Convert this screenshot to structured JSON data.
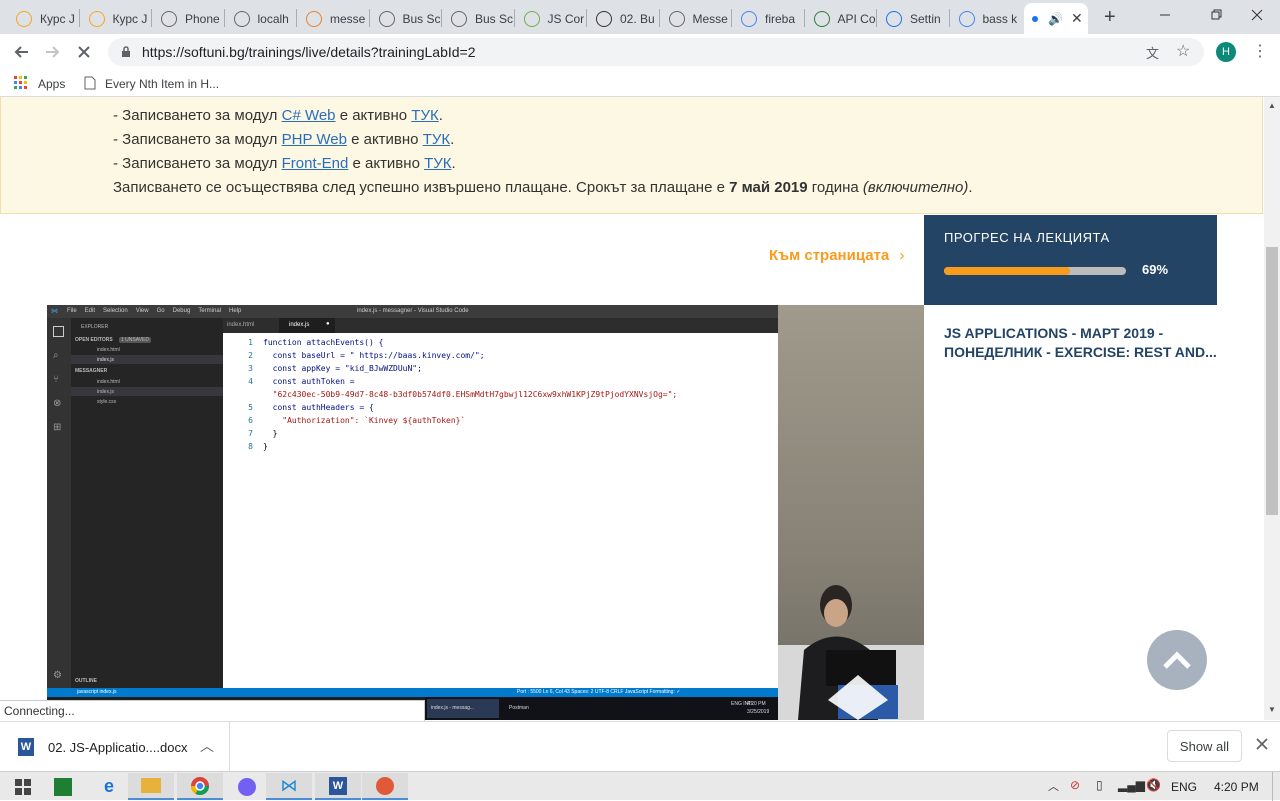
{
  "tabs": [
    {
      "title": "Курс J",
      "icon": "softuni-icon",
      "color": "#f5a623"
    },
    {
      "title": "Курс J",
      "icon": "softuni-icon",
      "color": "#f5a623"
    },
    {
      "title": "Phone",
      "icon": "document-icon",
      "color": "#666"
    },
    {
      "title": "localh",
      "icon": "document-icon",
      "color": "#666"
    },
    {
      "title": "messe",
      "icon": "bolt-icon",
      "color": "#e8832a"
    },
    {
      "title": "Bus Sc",
      "icon": "document-icon",
      "color": "#666"
    },
    {
      "title": "Bus Sc",
      "icon": "document-icon",
      "color": "#666"
    },
    {
      "title": "JS Cor",
      "icon": "s-icon",
      "color": "#6ab04c"
    },
    {
      "title": "02. Bu",
      "icon": "github-icon",
      "color": "#333"
    },
    {
      "title": "Messe",
      "icon": "document-icon",
      "color": "#666"
    },
    {
      "title": "fireba",
      "icon": "google-icon",
      "color": "#4285f4"
    },
    {
      "title": "API Co",
      "icon": "api-icon",
      "color": "#2e7d32"
    },
    {
      "title": "Settin",
      "icon": "gear-icon",
      "color": "#1a73e8"
    },
    {
      "title": "bass k",
      "icon": "google-icon",
      "color": "#4285f4"
    }
  ],
  "browser": {
    "url": "https://softuni.bg/trainings/live/details?trainingLabId=2",
    "profile_initial": "H",
    "bookmarks": [
      {
        "label": "Apps"
      },
      {
        "label": "Every Nth Item in H..."
      }
    ]
  },
  "notice": {
    "lines": [
      {
        "prefix": "- Записването за модул ",
        "link": "C# Web",
        "mid": " е активно ",
        "link2": "ТУК",
        "suffix": "."
      },
      {
        "prefix": "- Записването за модул ",
        "link": "PHP Web",
        "mid": " е активно ",
        "link2": "ТУК",
        "suffix": "."
      },
      {
        "prefix": "- Записването за модул ",
        "link": "Front-End",
        "mid": " е активно ",
        "link2": "ТУК",
        "suffix": "."
      }
    ],
    "payment_prefix": "Записването се осъществява след успешно извършено плащане. Срокът за плащане е ",
    "payment_date": "7 май 2019",
    "payment_mid": " година ",
    "payment_note": "(включително)",
    "payment_end": "."
  },
  "page": {
    "to_page_link": "Към страницата",
    "progress_label": "ПРОГРЕС НА ЛЕКЦИЯТА",
    "progress_value": 0.69,
    "progress_text": "69%",
    "lecture_title": "JS APPLICATIONS - МАРТ 2019 - ПОНЕДЕЛНИК - EXERCISE: REST AND...",
    "accent_color": "#f99b1c",
    "panel_color": "#234465"
  },
  "video": {
    "vs_title": "index.js - messagner - Visual Studio Code",
    "menu": [
      "File",
      "Edit",
      "Selection",
      "View",
      "Go",
      "Debug",
      "Terminal",
      "Help"
    ],
    "explorer_label": "EXPLORER",
    "open_editors_label": "OPEN EDITORS",
    "unsaved_label": "1 UNSAVED",
    "open_files": [
      "index.html",
      "index.js"
    ],
    "project_label": "MESSAGNER",
    "project_files": [
      "index.html",
      "index.js",
      "style.css"
    ],
    "outline_label": "OUTLINE",
    "editor_tabs": [
      "index.html",
      "index.js"
    ],
    "code_lines": [
      {
        "n": "1",
        "text": "function attachEvents() {"
      },
      {
        "n": "2",
        "text": "  const baseUrl = \" https://baas.kinvey.com/\";"
      },
      {
        "n": "3",
        "text": "  const appKey = \"kid_BJwWZDUuN\";"
      },
      {
        "n": "4",
        "text": "  const authToken ="
      },
      {
        "n": "",
        "text": "  \"62c430ec-50b9-49d7-8c48-b3df0b574df0.EHSmMdtH7gbwjl12C6xw9xhW1KPjZ9tPjodYXNVsjOg=\";"
      },
      {
        "n": "5",
        "text": "  const authHeaders = {"
      },
      {
        "n": "6",
        "text": "    \"Authorization\": `Kinvey ${authToken}`"
      },
      {
        "n": "7",
        "text": "  }"
      },
      {
        "n": "8",
        "text": "}"
      }
    ],
    "status_left": "javascript  index.js",
    "status_right": "Port : 5500   Ln 6, Col 43   Spaces: 2   UTF-8   CRLF   JavaScript   Formatting: ✓",
    "task_items": [
      "index.js - messag...",
      "Postman"
    ],
    "task_lang": "ENG INTL",
    "task_time": "4:20 PM",
    "task_date": "3/25/2019"
  },
  "status": {
    "connecting": "Connecting..."
  },
  "downloads": {
    "file_name": "02. JS-Applicatio....docx",
    "show_all": "Show all"
  },
  "taskbar": {
    "lang": "ENG",
    "time": "4:20 PM"
  }
}
